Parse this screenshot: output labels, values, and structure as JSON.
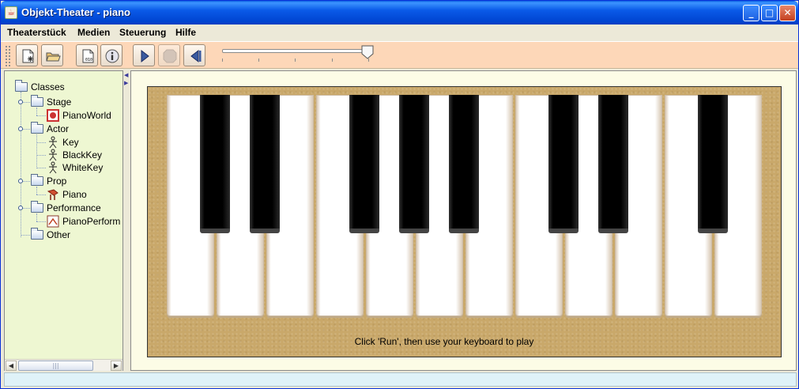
{
  "window": {
    "title": "Objekt-Theater - piano",
    "min_label": "_",
    "max_label": "□",
    "close_label": "✕"
  },
  "menu": {
    "items": [
      "Theaterstück",
      "Medien",
      "Steuerung",
      "Hilfe"
    ]
  },
  "toolbar": {
    "buttons": [
      "new-scenario",
      "open",
      "compile",
      "info",
      "run",
      "stop",
      "reset"
    ],
    "speed_slider": {
      "value": 0.97
    }
  },
  "tree": {
    "root": "Classes",
    "stage": {
      "label": "Stage",
      "children": [
        "PianoWorld"
      ]
    },
    "actor": {
      "label": "Actor",
      "children": [
        "Key",
        "BlackKey",
        "WhiteKey"
      ]
    },
    "prop": {
      "label": "Prop",
      "children": [
        "Piano"
      ]
    },
    "performance": {
      "label": "Performance",
      "children": [
        "PianoPerform"
      ]
    },
    "other": {
      "label": "Other"
    }
  },
  "world": {
    "hint": "Click 'Run', then use your keyboard to play",
    "white_keys": 12,
    "black_key_positions": [
      0,
      1,
      3,
      4,
      5,
      7,
      8,
      10
    ]
  },
  "colors": {
    "toolbar": "#fdd7b8",
    "tree_bg": "#eef7d2",
    "world_bg": "#c9a86a"
  }
}
